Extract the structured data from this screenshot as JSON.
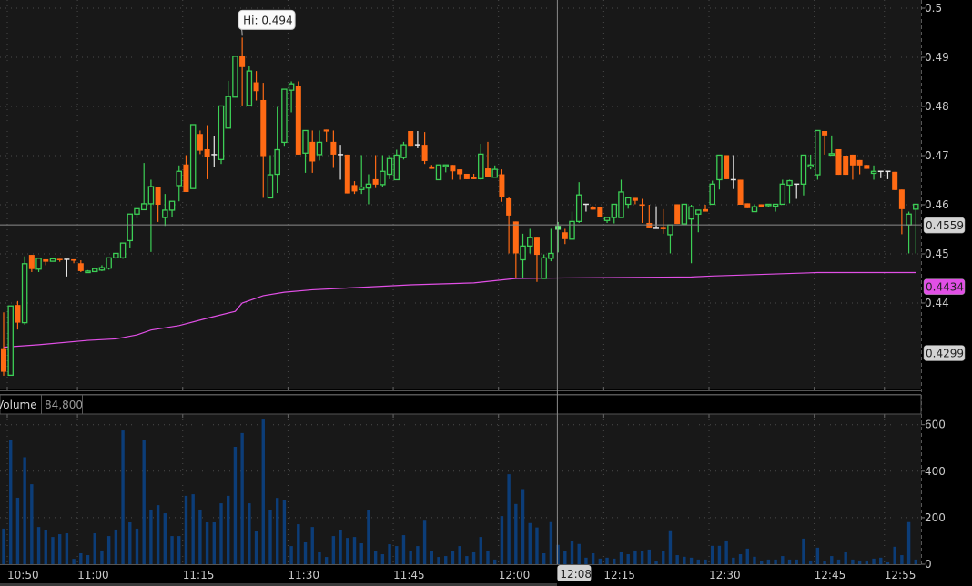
{
  "chart_data": {
    "type": "candlestick",
    "interval_minutes": 1,
    "start_time": "10:49",
    "price_axis": {
      "ylim": [
        0.4224,
        0.5017
      ],
      "ticks": [
        "0.5",
        "0.49",
        "0.48",
        "0.47",
        "0.46",
        "0.45",
        "0.44"
      ]
    },
    "volume_axis": {
      "ylim": [
        0,
        645
      ],
      "ticks": [
        "600",
        "400",
        "200",
        "0"
      ]
    },
    "time_ticks": [
      "10:50",
      "11:00",
      "11:15",
      "11:30",
      "11:45",
      "12:00",
      "12:15",
      "12:30",
      "12:45",
      "12:55"
    ],
    "grid": true,
    "candles_format": [
      "open",
      "high",
      "low",
      "close",
      "volume"
    ],
    "candles": [
      [
        0.4308,
        0.4381,
        0.4252,
        0.426,
        153
      ],
      [
        0.4253,
        0.4394,
        0.4253,
        0.4394,
        535
      ],
      [
        0.4396,
        0.4404,
        0.4346,
        0.436,
        286
      ],
      [
        0.436,
        0.4495,
        0.4356,
        0.448,
        460
      ],
      [
        0.4498,
        0.4498,
        0.4463,
        0.4469,
        344
      ],
      [
        0.4469,
        0.4491,
        0.4463,
        0.4491,
        160
      ],
      [
        0.4489,
        0.4489,
        0.4477,
        0.4484,
        145
      ],
      [
        0.4485,
        0.449,
        0.4485,
        0.449,
        117
      ],
      [
        0.449,
        0.449,
        0.4484,
        0.4487,
        129
      ],
      [
        0.4489,
        0.4489,
        0.4454,
        0.4489,
        133
      ],
      [
        0.4489,
        0.4489,
        0.4481,
        0.4486,
        23
      ],
      [
        0.4481,
        0.4487,
        0.4463,
        0.4465,
        47
      ],
      [
        0.4462,
        0.4467,
        0.4462,
        0.4465,
        39
      ],
      [
        0.4464,
        0.4472,
        0.4463,
        0.447,
        133
      ],
      [
        0.4467,
        0.4477,
        0.4465,
        0.4472,
        59
      ],
      [
        0.4471,
        0.4492,
        0.4468,
        0.4492,
        121
      ],
      [
        0.4492,
        0.4501,
        0.449,
        0.4501,
        149
      ],
      [
        0.4492,
        0.4522,
        0.449,
        0.4522,
        575
      ],
      [
        0.4527,
        0.4581,
        0.4513,
        0.4581,
        180
      ],
      [
        0.4581,
        0.4592,
        0.4572,
        0.4592,
        153
      ],
      [
        0.459,
        0.4685,
        0.459,
        0.4602,
        536
      ],
      [
        0.4602,
        0.4651,
        0.4504,
        0.4637,
        235
      ],
      [
        0.4637,
        0.4637,
        0.4565,
        0.46,
        254
      ],
      [
        0.4574,
        0.4622,
        0.4557,
        0.4589,
        219
      ],
      [
        0.4589,
        0.4607,
        0.4574,
        0.4607,
        121
      ],
      [
        0.4639,
        0.468,
        0.4607,
        0.4668,
        121
      ],
      [
        0.4682,
        0.4701,
        0.4626,
        0.4626,
        294
      ],
      [
        0.4633,
        0.4763,
        0.4633,
        0.4763,
        301
      ],
      [
        0.4744,
        0.4751,
        0.4703,
        0.471,
        235
      ],
      [
        0.4713,
        0.4762,
        0.4652,
        0.4697,
        180
      ],
      [
        0.4702,
        0.474,
        0.4677,
        0.4702,
        180
      ],
      [
        0.4692,
        0.4801,
        0.4683,
        0.4801,
        262
      ],
      [
        0.4756,
        0.4852,
        0.4756,
        0.482,
        294
      ],
      [
        0.4819,
        0.4902,
        0.4819,
        0.4902,
        505
      ],
      [
        0.4902,
        0.494,
        0.4802,
        0.488,
        564
      ],
      [
        0.4802,
        0.4883,
        0.4802,
        0.4872,
        262
      ],
      [
        0.4849,
        0.4872,
        0.4812,
        0.4831,
        141
      ],
      [
        0.4813,
        0.4848,
        0.4614,
        0.4699,
        622
      ],
      [
        0.4614,
        0.4701,
        0.4614,
        0.4661,
        232
      ],
      [
        0.4662,
        0.4799,
        0.4624,
        0.4712,
        285
      ],
      [
        0.4727,
        0.4835,
        0.472,
        0.4835,
        277
      ],
      [
        0.4833,
        0.4851,
        0.4788,
        0.4846,
        78
      ],
      [
        0.4841,
        0.4851,
        0.4702,
        0.4702,
        172
      ],
      [
        0.4705,
        0.4751,
        0.4665,
        0.4751,
        94
      ],
      [
        0.4728,
        0.4751,
        0.4665,
        0.4688,
        160
      ],
      [
        0.4702,
        0.4751,
        0.469,
        0.4727,
        51
      ],
      [
        0.4753,
        0.4753,
        0.4728,
        0.4749,
        31
      ],
      [
        0.4728,
        0.4751,
        0.4675,
        0.4702,
        121
      ],
      [
        0.4702,
        0.4722,
        0.4651,
        0.4702,
        148
      ],
      [
        0.4702,
        0.4702,
        0.4623,
        0.4623,
        113
      ],
      [
        0.464,
        0.4648,
        0.4622,
        0.4627,
        117
      ],
      [
        0.4631,
        0.4701,
        0.4622,
        0.4636,
        90
      ],
      [
        0.4634,
        0.4662,
        0.4601,
        0.4642,
        234
      ],
      [
        0.4652,
        0.4701,
        0.4634,
        0.4641,
        55
      ],
      [
        0.4641,
        0.4701,
        0.4636,
        0.4668,
        43
      ],
      [
        0.4662,
        0.4701,
        0.4652,
        0.4694,
        86
      ],
      [
        0.4651,
        0.4712,
        0.4651,
        0.4701,
        78
      ],
      [
        0.4696,
        0.4728,
        0.4692,
        0.4722,
        125
      ],
      [
        0.475,
        0.475,
        0.472,
        0.472,
        59
      ],
      [
        0.4722,
        0.475,
        0.4715,
        0.4722,
        78
      ],
      [
        0.4722,
        0.4748,
        0.4683,
        0.4689,
        187
      ],
      [
        0.4678,
        0.4681,
        0.4673,
        0.4673,
        55
      ],
      [
        0.4651,
        0.4681,
        0.4651,
        0.4681,
        31
      ],
      [
        0.4678,
        0.4681,
        0.4666,
        0.4681,
        35
      ],
      [
        0.4681,
        0.4681,
        0.4651,
        0.4668,
        55
      ],
      [
        0.4672,
        0.4672,
        0.4651,
        0.4662,
        78
      ],
      [
        0.4663,
        0.4663,
        0.4652,
        0.4652,
        35
      ],
      [
        0.4656,
        0.4663,
        0.4652,
        0.4652,
        51
      ],
      [
        0.4653,
        0.4724,
        0.4651,
        0.4703,
        117
      ],
      [
        0.4674,
        0.4728,
        0.4656,
        0.4656,
        55
      ],
      [
        0.4656,
        0.468,
        0.4656,
        0.4672,
        20
      ],
      [
        0.4662,
        0.4672,
        0.4606,
        0.4615,
        207
      ],
      [
        0.4613,
        0.4615,
        0.4501,
        0.4578,
        387
      ],
      [
        0.4566,
        0.4566,
        0.445,
        0.4501,
        259
      ],
      [
        0.4488,
        0.4541,
        0.445,
        0.4516,
        323
      ],
      [
        0.4516,
        0.4551,
        0.4501,
        0.4533,
        177
      ],
      [
        0.4533,
        0.4533,
        0.4443,
        0.4498,
        158
      ],
      [
        0.445,
        0.4499,
        0.445,
        0.4492,
        47
      ],
      [
        0.4491,
        0.4551,
        0.4485,
        0.4501,
        181
      ],
      [
        0.4549,
        0.4565,
        0.4503,
        0.4557,
        83
      ],
      [
        0.4544,
        0.4551,
        0.452,
        0.453,
        55
      ],
      [
        0.453,
        0.4586,
        0.453,
        0.4566,
        98
      ],
      [
        0.4566,
        0.4646,
        0.4563,
        0.462,
        87
      ],
      [
        0.4601,
        0.4601,
        0.4586,
        0.4601,
        28
      ],
      [
        0.4595,
        0.4597,
        0.459,
        0.459,
        47
      ],
      [
        0.4595,
        0.4595,
        0.4575,
        0.4575,
        24
      ],
      [
        0.4568,
        0.4574,
        0.4563,
        0.4574,
        28
      ],
      [
        0.4574,
        0.4601,
        0.4562,
        0.4601,
        24
      ],
      [
        0.4574,
        0.4651,
        0.4574,
        0.4626,
        51
      ],
      [
        0.4601,
        0.4614,
        0.4592,
        0.4614,
        43
      ],
      [
        0.4614,
        0.4614,
        0.4601,
        0.4608,
        59
      ],
      [
        0.4601,
        0.4612,
        0.4563,
        0.4598,
        55
      ],
      [
        0.4563,
        0.46,
        0.4552,
        0.4552,
        63
      ],
      [
        0.4552,
        0.4597,
        0.4552,
        0.4552,
        12
      ],
      [
        0.4553,
        0.4591,
        0.4541,
        0.4552,
        55
      ],
      [
        0.4539,
        0.4559,
        0.4501,
        0.4559,
        142
      ],
      [
        0.4601,
        0.4601,
        0.4561,
        0.4561,
        39
      ],
      [
        0.4561,
        0.4601,
        0.4561,
        0.4601,
        32
      ],
      [
        0.4571,
        0.46,
        0.4481,
        0.4596,
        28
      ],
      [
        0.4581,
        0.4589,
        0.4544,
        0.4589,
        20
      ],
      [
        0.4591,
        0.46,
        0.4586,
        0.4586,
        20
      ],
      [
        0.4601,
        0.4649,
        0.4601,
        0.4642,
        79
      ],
      [
        0.4651,
        0.4701,
        0.4631,
        0.4701,
        79
      ],
      [
        0.4701,
        0.4701,
        0.4652,
        0.4652,
        102
      ],
      [
        0.4651,
        0.4701,
        0.4632,
        0.4651,
        28
      ],
      [
        0.4651,
        0.4651,
        0.46,
        0.46,
        43
      ],
      [
        0.4603,
        0.4603,
        0.4593,
        0.4593,
        67
      ],
      [
        0.4586,
        0.4601,
        0.4586,
        0.4596,
        32
      ],
      [
        0.4601,
        0.4601,
        0.4595,
        0.4595,
        12
      ],
      [
        0.4599,
        0.4601,
        0.4596,
        0.4601,
        20
      ],
      [
        0.4597,
        0.4601,
        0.4586,
        0.4601,
        20
      ],
      [
        0.4601,
        0.4651,
        0.4601,
        0.4642,
        35
      ],
      [
        0.464,
        0.4651,
        0.4603,
        0.4649,
        20
      ],
      [
        0.4642,
        0.4642,
        0.4612,
        0.4642,
        20
      ],
      [
        0.4642,
        0.4701,
        0.4619,
        0.4701,
        110
      ],
      [
        0.4677,
        0.4702,
        0.4672,
        0.4681,
        16
      ],
      [
        0.4661,
        0.4751,
        0.4651,
        0.4751,
        71
      ],
      [
        0.475,
        0.475,
        0.4702,
        0.4741,
        12
      ],
      [
        0.4701,
        0.4741,
        0.4701,
        0.4704,
        35
      ],
      [
        0.4713,
        0.4713,
        0.4661,
        0.4661,
        20
      ],
      [
        0.47,
        0.47,
        0.4661,
        0.4661,
        51
      ],
      [
        0.4702,
        0.4702,
        0.4651,
        0.468,
        20
      ],
      [
        0.4691,
        0.4691,
        0.4662,
        0.468,
        16
      ],
      [
        0.4681,
        0.4681,
        0.4673,
        0.4673,
        16
      ],
      [
        0.4664,
        0.468,
        0.4651,
        0.4668,
        24
      ],
      [
        0.4668,
        0.4668,
        0.4654,
        0.4668,
        28
      ],
      [
        0.4668,
        0.4668,
        0.4652,
        0.4668,
        8
      ],
      [
        0.4667,
        0.4667,
        0.463,
        0.463,
        75
      ],
      [
        0.4631,
        0.4631,
        0.454,
        0.4591,
        39
      ],
      [
        0.4559,
        0.4586,
        0.4501,
        0.4581,
        181
      ],
      [
        0.4591,
        0.4601,
        0.4501,
        0.4601,
        20
      ]
    ],
    "vwap": [
      [
        0,
        0.431
      ],
      [
        5,
        0.4315
      ],
      [
        12,
        0.4324
      ],
      [
        16,
        0.4327
      ],
      [
        19,
        0.4335
      ],
      [
        21,
        0.4345
      ],
      [
        25,
        0.4354
      ],
      [
        29,
        0.4369
      ],
      [
        33,
        0.4383
      ],
      [
        34,
        0.44
      ],
      [
        37,
        0.4415
      ],
      [
        40,
        0.4422
      ],
      [
        44,
        0.4427
      ],
      [
        51,
        0.4432
      ],
      [
        58,
        0.4437
      ],
      [
        67,
        0.4441
      ],
      [
        73,
        0.445
      ],
      [
        80,
        0.4451
      ],
      [
        98,
        0.4453
      ],
      [
        101,
        0.4455
      ],
      [
        116,
        0.4462
      ],
      [
        130,
        0.4462
      ]
    ],
    "high_marker": {
      "label": "Hi: 0.494",
      "value": 0.494,
      "candle": 34
    },
    "price_labels": [
      {
        "text": "0.4559",
        "value": 0.4559,
        "kind": "crosshair"
      },
      {
        "text": "0.4434",
        "value": 0.4434,
        "kind": "vwap"
      },
      {
        "text": "0.4299",
        "value": 0.4299,
        "kind": "reference"
      }
    ],
    "crosshair": {
      "time": "12:08",
      "price": 0.4559
    }
  },
  "volume_header": {
    "label": "Volume",
    "value": "84,800"
  },
  "colors": {
    "up": "#3ccf55",
    "down": "#ff6a14",
    "doji": "#e6e6e6",
    "hover": "#6df07f",
    "volume": "#0c3d78",
    "vwap": "#e14fe6",
    "panel": "#181818",
    "grid": "#4a4a4a"
  }
}
